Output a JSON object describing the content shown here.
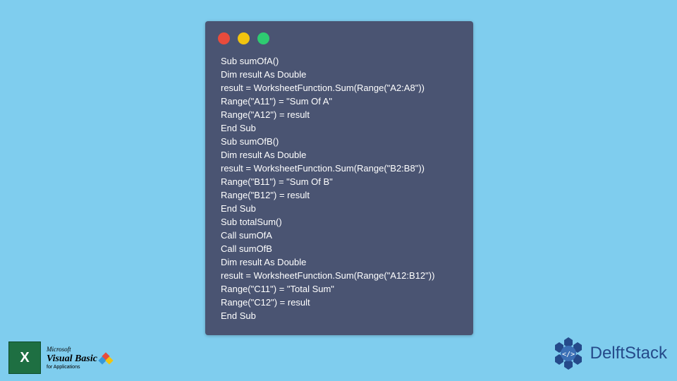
{
  "code": {
    "lines": [
      "Sub sumOfA()",
      "Dim result As Double",
      "result = WorksheetFunction.Sum(Range(\"A2:A8\"))",
      "Range(\"A11\") = \"Sum Of A\"",
      "Range(\"A12\") = result",
      "End Sub",
      "Sub sumOfB()",
      "Dim result As Double",
      "result = WorksheetFunction.Sum(Range(\"B2:B8\"))",
      "Range(\"B11\") = \"Sum Of B\"",
      "Range(\"B12\") = result",
      "End Sub",
      "Sub totalSum()",
      "Call sumOfA",
      "Call sumOfB",
      "Dim result As Double",
      "result = WorksheetFunction.Sum(Range(\"A12:B12\"))",
      "Range(\"C11\") = \"Total Sum\"",
      "Range(\"C12\") = result",
      "End Sub"
    ]
  },
  "footer": {
    "excel_letter": "X",
    "vb_microsoft": "Microsoft",
    "vb_name": "Visual Basic",
    "vb_sub": "for Applications",
    "brand_prefix": "Delft",
    "brand_suffix": "Stack"
  },
  "colors": {
    "bg": "#7fcdee",
    "panel": "#4a5472",
    "brand": "#254a8a"
  }
}
